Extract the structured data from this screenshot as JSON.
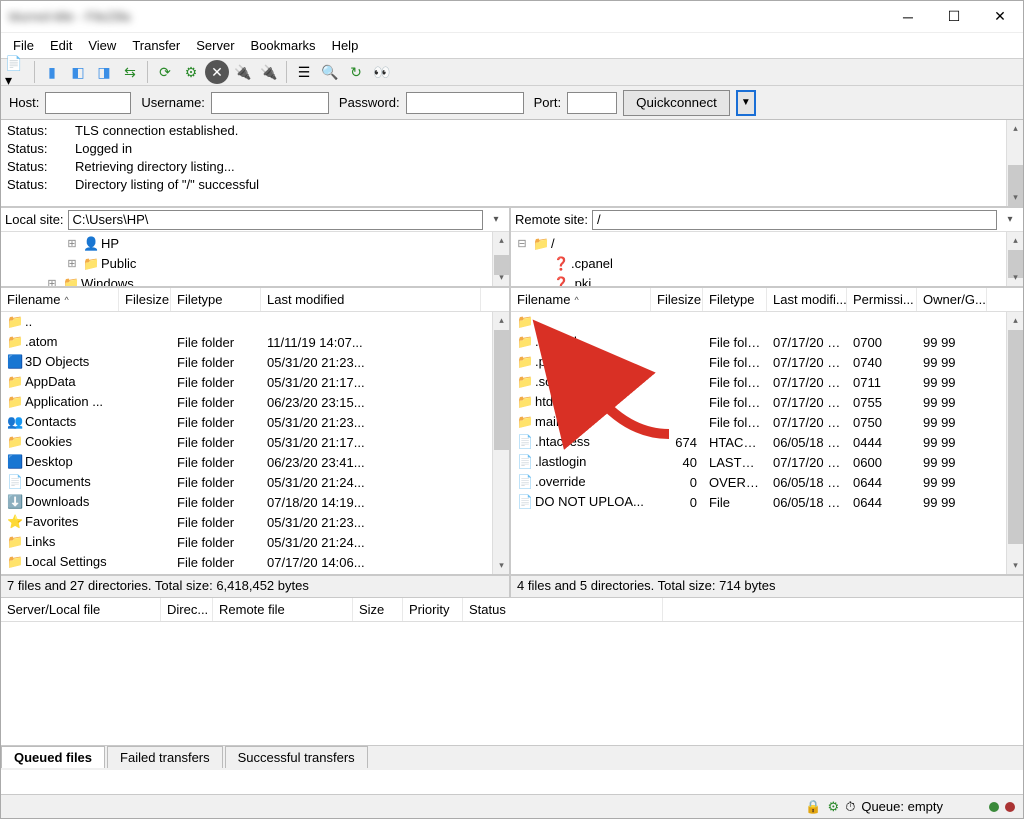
{
  "window_title": "blurred-title - FileZilla",
  "menu": [
    "File",
    "Edit",
    "View",
    "Transfer",
    "Server",
    "Bookmarks",
    "Help"
  ],
  "connect": {
    "host_label": "Host:",
    "username_label": "Username:",
    "password_label": "Password:",
    "port_label": "Port:",
    "quickconnect_label": "Quickconnect"
  },
  "log": [
    {
      "label": "Status:",
      "text": "TLS connection established."
    },
    {
      "label": "Status:",
      "text": "Logged in"
    },
    {
      "label": "Status:",
      "text": "Retrieving directory listing..."
    },
    {
      "label": "Status:",
      "text": "Directory listing of \"/\" successful"
    }
  ],
  "local": {
    "site_label": "Local site:",
    "path": "C:\\Users\\HP\\",
    "tree": [
      {
        "icon": "user",
        "name": "HP",
        "indent": 3,
        "expander": "⊞"
      },
      {
        "icon": "folder",
        "name": "Public",
        "indent": 3,
        "expander": "⊞"
      },
      {
        "icon": "folder",
        "name": "Windows",
        "indent": 2,
        "expander": "⊞"
      }
    ],
    "cols": [
      "Filename",
      "Filesize",
      "Filetype",
      "Last modified"
    ],
    "rows": [
      {
        "icon": "folder",
        "name": "..",
        "size": "",
        "type": "",
        "mod": ""
      },
      {
        "icon": "folder",
        "name": ".atom",
        "size": "",
        "type": "File folder",
        "mod": "11/11/19 14:07..."
      },
      {
        "icon": "cube",
        "name": "3D Objects",
        "size": "",
        "type": "File folder",
        "mod": "05/31/20 21:23..."
      },
      {
        "icon": "folder",
        "name": "AppData",
        "size": "",
        "type": "File folder",
        "mod": "05/31/20 21:17..."
      },
      {
        "icon": "folder",
        "name": "Application ...",
        "size": "",
        "type": "File folder",
        "mod": "06/23/20 23:15..."
      },
      {
        "icon": "contacts",
        "name": "Contacts",
        "size": "",
        "type": "File folder",
        "mod": "05/31/20 21:23..."
      },
      {
        "icon": "folder",
        "name": "Cookies",
        "size": "",
        "type": "File folder",
        "mod": "05/31/20 21:17..."
      },
      {
        "icon": "desktop",
        "name": "Desktop",
        "size": "",
        "type": "File folder",
        "mod": "06/23/20 23:41..."
      },
      {
        "icon": "doc",
        "name": "Documents",
        "size": "",
        "type": "File folder",
        "mod": "05/31/20 21:24..."
      },
      {
        "icon": "download",
        "name": "Downloads",
        "size": "",
        "type": "File folder",
        "mod": "07/18/20 14:19..."
      },
      {
        "icon": "fav",
        "name": "Favorites",
        "size": "",
        "type": "File folder",
        "mod": "05/31/20 21:23..."
      },
      {
        "icon": "folder",
        "name": "Links",
        "size": "",
        "type": "File folder",
        "mod": "05/31/20 21:24..."
      },
      {
        "icon": "folder",
        "name": "Local Settings",
        "size": "",
        "type": "File folder",
        "mod": "07/17/20 14:06..."
      }
    ],
    "summary": "7 files and 27 directories. Total size: 6,418,452 bytes"
  },
  "remote": {
    "site_label": "Remote site:",
    "path": "/",
    "tree": [
      {
        "icon": "folder",
        "name": "/",
        "indent": 0,
        "expander": "⊟"
      },
      {
        "icon": "unk",
        "name": ".cpanel",
        "indent": 1,
        "expander": ""
      },
      {
        "icon": "unk",
        "name": ".pki",
        "indent": 1,
        "expander": ""
      }
    ],
    "cols": [
      "Filename",
      "Filesize",
      "Filetype",
      "Last modifi...",
      "Permissi...",
      "Owner/G..."
    ],
    "rows": [
      {
        "icon": "folder",
        "name": "..",
        "size": "",
        "type": "",
        "mod": "",
        "perm": "",
        "own": ""
      },
      {
        "icon": "folder",
        "name": ".cpanel",
        "size": "",
        "type": "File folder",
        "mod": "07/17/20 2...",
        "perm": "0700",
        "own": "99 99"
      },
      {
        "icon": "folder",
        "name": ".pki",
        "size": "",
        "type": "File folder",
        "mod": "07/17/20 2...",
        "perm": "0740",
        "own": "99 99"
      },
      {
        "icon": "folder",
        "name": ".softaculous",
        "size": "",
        "type": "File folder",
        "mod": "07/17/20 2...",
        "perm": "0711",
        "own": "99 99"
      },
      {
        "icon": "folder",
        "name": "htdocs",
        "size": "",
        "type": "File folder",
        "mod": "07/17/20 2...",
        "perm": "0755",
        "own": "99 99"
      },
      {
        "icon": "folder",
        "name": "mail",
        "size": "",
        "type": "File folder",
        "mod": "07/17/20 2...",
        "perm": "0750",
        "own": "99 99"
      },
      {
        "icon": "file",
        "name": ".htaccess",
        "size": "674",
        "type": "HTACCE...",
        "mod": "06/05/18 2...",
        "perm": "0444",
        "own": "99 99"
      },
      {
        "icon": "file",
        "name": ".lastlogin",
        "size": "40",
        "type": "LASTLO...",
        "mod": "07/17/20 2...",
        "perm": "0600",
        "own": "99 99"
      },
      {
        "icon": "file",
        "name": ".override",
        "size": "0",
        "type": "OVERRI...",
        "mod": "06/05/18 2...",
        "perm": "0644",
        "own": "99 99"
      },
      {
        "icon": "file",
        "name": "DO NOT UPLOA...",
        "size": "0",
        "type": "File",
        "mod": "06/05/18 2...",
        "perm": "0644",
        "own": "99 99"
      }
    ],
    "summary": "4 files and 5 directories. Total size: 714 bytes"
  },
  "transfer_cols": [
    "Server/Local file",
    "Direc...",
    "Remote file",
    "Size",
    "Priority",
    "Status"
  ],
  "tabs": [
    "Queued files",
    "Failed transfers",
    "Successful transfers"
  ],
  "status": {
    "queue": "Queue: empty"
  }
}
